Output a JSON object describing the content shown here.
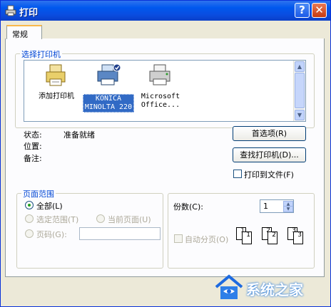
{
  "window": {
    "title": "打印"
  },
  "titlebar": {
    "help_label": "?",
    "close_label": "✕"
  },
  "tabs": [
    {
      "label": "常规"
    }
  ],
  "select_printer": {
    "group_label": "选择打印机",
    "printers": [
      {
        "label_line1": "添加打印机",
        "label_line2": "",
        "icon": "add-printer-icon",
        "selected": false
      },
      {
        "label_line1": "KONICA",
        "label_line2": "MINOLTA 220",
        "icon": "printer-icon",
        "selected": true
      },
      {
        "label_line1": "Microsoft",
        "label_line2": "Office...",
        "icon": "printer-icon",
        "selected": false
      }
    ]
  },
  "status": {
    "status_label": "状态:",
    "status_value": "准备就绪",
    "location_label": "位置:",
    "comment_label": "备注:"
  },
  "buttons": {
    "preferences": "首选项(R)",
    "find_printer": "查找打印机(D)..."
  },
  "print_to_file": {
    "label": "打印到文件(F)",
    "checked": false
  },
  "page_range": {
    "group_label": "页面范围",
    "all": "全部(L)",
    "selection": "选定范围(T)",
    "current_page": "当前页面(U)",
    "pages": "页码(G):",
    "pages_value": ""
  },
  "copies": {
    "label": "份数(C):",
    "value": "1",
    "collate_label": "自动分页(O)",
    "collate_checked": false,
    "collate_pages": [
      "1",
      "1",
      "2",
      "2",
      "3",
      "3"
    ]
  },
  "watermark": {
    "text": "系统之家"
  },
  "colors": {
    "title_bar": "#0a4de0",
    "accent_label": "#0046d5",
    "dialog_bg": "#ece9d8"
  }
}
